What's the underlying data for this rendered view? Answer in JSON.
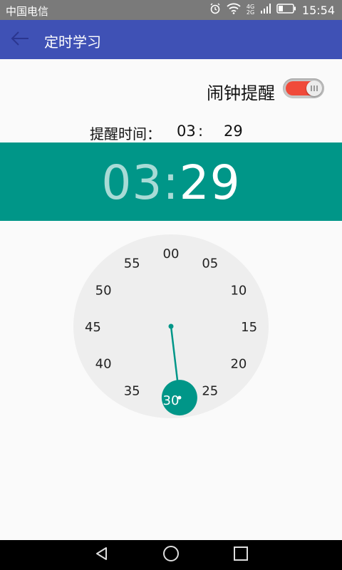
{
  "status_bar": {
    "carrier": "中国电信",
    "network": "4G 2G",
    "time": "15:54",
    "icons": [
      "alarm-icon",
      "wifi-icon",
      "signal-icon",
      "battery-icon"
    ]
  },
  "app_bar": {
    "title": "定时学习",
    "back_icon": "arrow-left-icon",
    "color": "#3f51b5"
  },
  "alarm": {
    "label": "闹钟提醒",
    "enabled": true,
    "toggle_color": "#f04a3a"
  },
  "reminder": {
    "label": "提醒时间：",
    "hour": "03",
    "separator": ":",
    "minute": "29"
  },
  "picker_header": {
    "hour": "03",
    "separator": ":",
    "minute": "29",
    "color": "#009688"
  },
  "clock": {
    "labels": [
      "00",
      "05",
      "10",
      "15",
      "20",
      "25",
      "30",
      "35",
      "40",
      "45",
      "50",
      "55"
    ],
    "selected_label": "30",
    "selected_minute": 29,
    "face_color": "#eeeeee",
    "accent_color": "#009688"
  },
  "nav_bar": {
    "icons": [
      "back-triangle-icon",
      "home-circle-icon",
      "recents-square-icon"
    ]
  }
}
